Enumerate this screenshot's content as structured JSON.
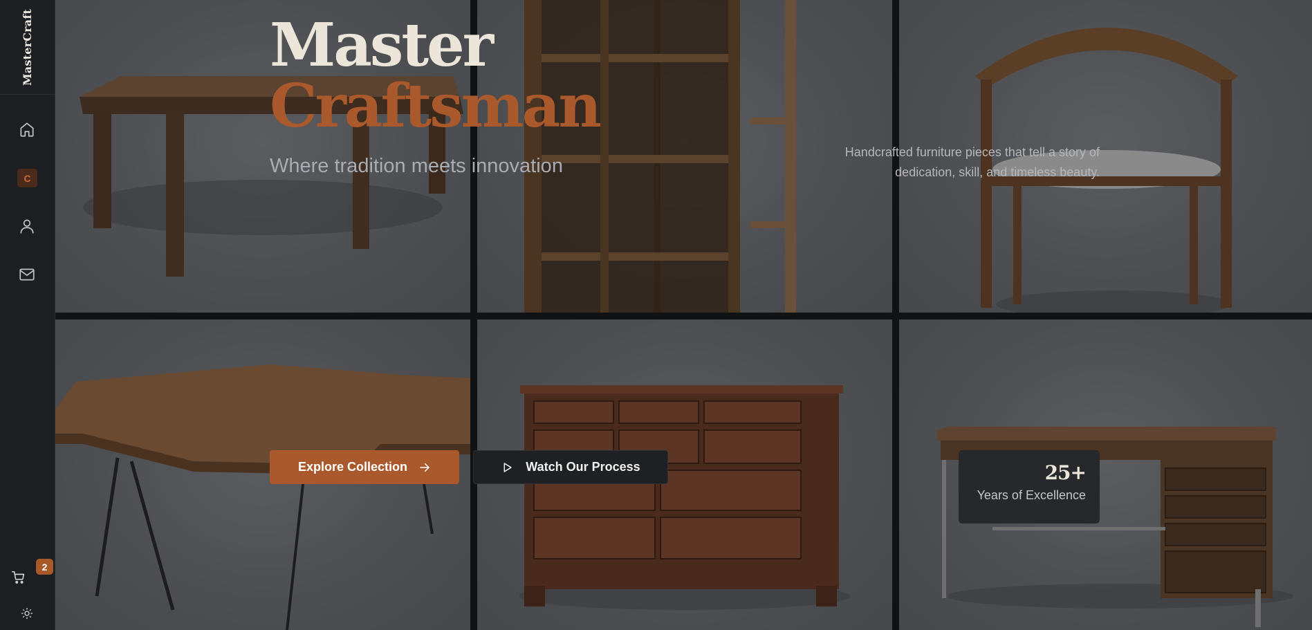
{
  "brand": {
    "name": "MasterCraft"
  },
  "sidebar": {
    "items": [
      {
        "name": "home",
        "icon": "home-icon"
      },
      {
        "name": "collection",
        "label": "C",
        "active": true
      },
      {
        "name": "profile",
        "icon": "user-icon"
      },
      {
        "name": "contact",
        "icon": "mail-icon"
      }
    ],
    "cart": {
      "icon": "cart-icon",
      "count": "2"
    },
    "theme": {
      "icon": "sun-icon"
    }
  },
  "hero": {
    "title_line1": "Master",
    "title_line2": "Craftsman",
    "tagline": "Where tradition meets innovation",
    "description": "Handcrafted furniture pieces that tell a story of dedication, skill, and timeless beauty.",
    "primary_button": "Explore Collection",
    "secondary_button": "Watch Our Process",
    "stat": {
      "value": "25+",
      "label": "Years of Excellence"
    }
  },
  "colors": {
    "accent": "#a9592b",
    "sidebar_bg": "#1c1e21",
    "title_light": "#ece6da"
  },
  "gallery": [
    {
      "name": "gallery-dining-table"
    },
    {
      "name": "gallery-bookshelf"
    },
    {
      "name": "gallery-armchair"
    },
    {
      "name": "gallery-live-edge-table"
    },
    {
      "name": "gallery-dresser"
    },
    {
      "name": "gallery-desk"
    }
  ]
}
